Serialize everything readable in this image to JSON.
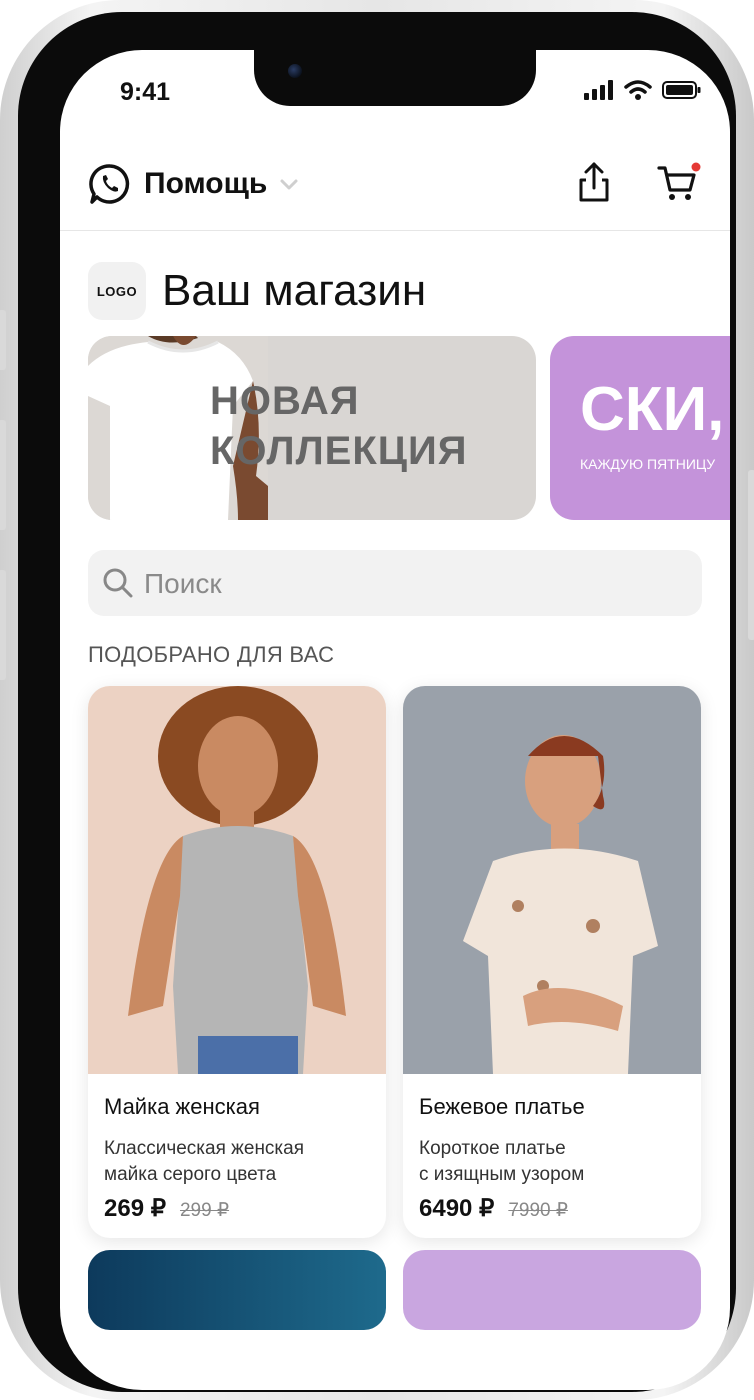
{
  "status": {
    "time": "9:41"
  },
  "header": {
    "help_label": "Помощь"
  },
  "shop": {
    "logo_text": "LOGO",
    "title": "Ваш магазин"
  },
  "banners": [
    {
      "line1": "НОВАЯ",
      "line2": "КОЛЛЕКЦИЯ"
    },
    {
      "big": "СКИ,",
      "small": "КАЖДУЮ ПЯТНИЦУ"
    }
  ],
  "search": {
    "placeholder": "Поиск"
  },
  "section_title": "ПОДОБРАНО ДЛЯ ВАС",
  "products": [
    {
      "title": "Майка женская",
      "desc_line1": "Классическая женская",
      "desc_line2": "майка серого цвета",
      "price": "269 ₽",
      "old_price": "299 ₽"
    },
    {
      "title": "Бежевое платье",
      "desc_line1": "Короткое платье",
      "desc_line2": "с изящным узором",
      "price": "6490 ₽",
      "old_price": "7990 ₽"
    }
  ],
  "colors": {
    "accent_purple": "#c493da",
    "cart_badge": "#e53935",
    "banner_gray": "#d9d6d3"
  }
}
